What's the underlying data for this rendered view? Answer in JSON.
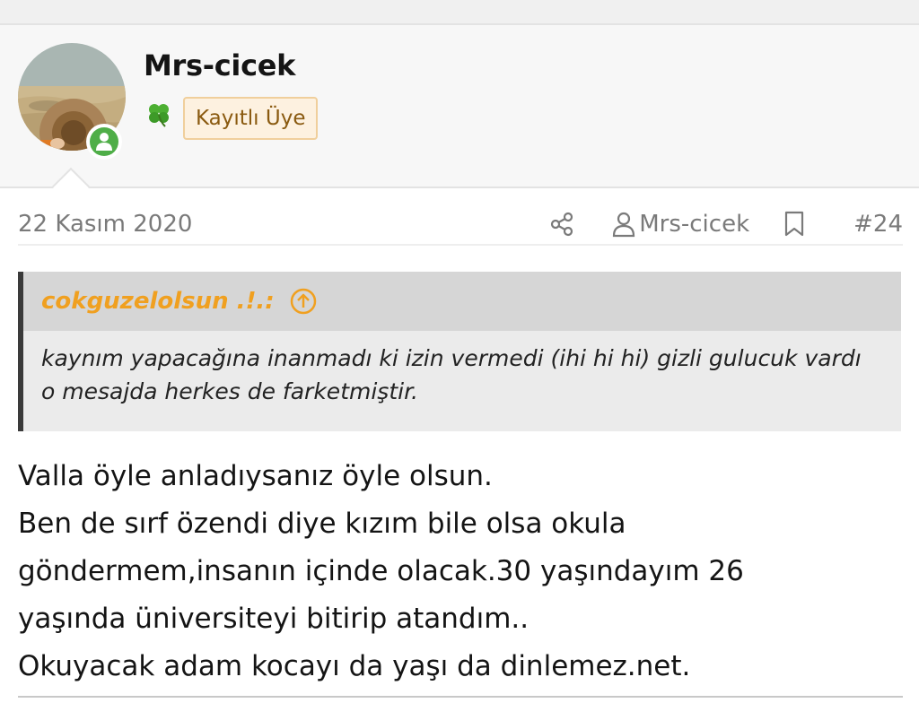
{
  "post": {
    "author": {
      "name": "Mrs-cicek",
      "role_badge": "Kayıtlı Üye",
      "avatar_icon": "avatar-photo",
      "status_icon": "online-user-icon",
      "rank_icon": "clover-icon"
    },
    "meta": {
      "date": "22 Kasım 2020",
      "author_link": "Mrs-cicek",
      "post_number": "#24",
      "share_icon": "share-icon",
      "bookmark_icon": "bookmark-icon"
    },
    "quote": {
      "author": "cokguzelolsun .!.:",
      "body": "kaynım yapacağına inanmadı ki izin vermedi (ihi hi hi) gizli gulucuk vardı o mesajda herkes de farketmiştir."
    },
    "message_lines": [
      "Valla öyle anladıysanız öyle olsun.",
      "Ben de sırf özendi diye kızım bile olsa okula",
      "göndermem,insanın içinde olacak.30 yaşındayım 26",
      "yaşında üniversiteyi bitirip atandım..",
      "Okuyacak adam kocayı da yaşı da dinlemez.net."
    ]
  },
  "colors": {
    "quote_author": "#f0a020",
    "online_green": "#4fae48",
    "badge_bg": "#fdf1e0",
    "badge_border": "#f0cf9c",
    "badge_text": "#8a5a10"
  }
}
